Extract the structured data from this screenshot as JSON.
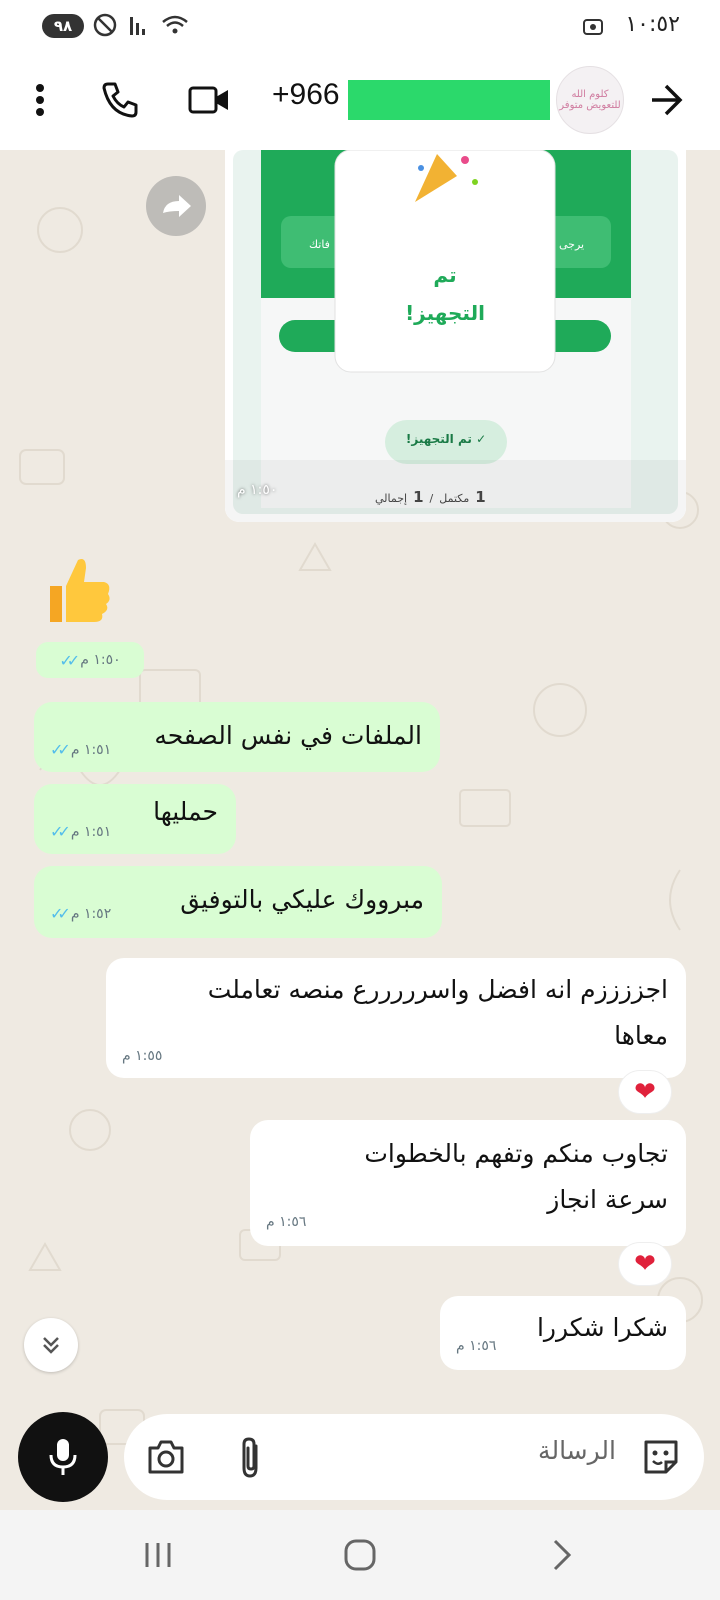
{
  "status_bar": {
    "battery": "٩٨",
    "time": "١٠:٥٢"
  },
  "header": {
    "contact_prefix": "+966",
    "avatar_text": "كلوم الله\nللتعويض متوفر"
  },
  "image_message": {
    "popup_title": "تم\nالتجهيز!",
    "badge": "✓ تم التجهيز!",
    "stat_complete_num": "1",
    "stat_complete_label": "مكتمل",
    "separator": "/",
    "stat_total_num": "1",
    "stat_total_label": "إجمالي",
    "banner_text_right": "يرجى",
    "banner_text_left": "فاتك",
    "time": "١:٥٠ م"
  },
  "messages": [
    {
      "id": "thumbs",
      "direction": "out",
      "emoji": "👍",
      "time": "١:٥٠ م",
      "read": true
    },
    {
      "id": "m1",
      "direction": "out",
      "text": "الملفات في نفس الصفحه",
      "time": "١:٥١ م",
      "read": true
    },
    {
      "id": "m2",
      "direction": "out",
      "text": "حمليها",
      "time": "١:٥١ م",
      "read": true
    },
    {
      "id": "m3",
      "direction": "out",
      "text": "مبرووك عليكي بالتوفيق",
      "time": "١:٥٢ م",
      "read": true
    },
    {
      "id": "m4",
      "direction": "in",
      "text_line1": "اجززززم انه افضل واسرررررع منصه تعاملت",
      "text_line2": "معاها",
      "time": "١:٥٥ م",
      "reaction": "❤"
    },
    {
      "id": "m5",
      "direction": "in",
      "text_line1": "تجاوب منكم وتفهم بالخطوات",
      "text_line2": "سرعة انجاز",
      "time": "١:٥٦ م",
      "reaction": "❤"
    },
    {
      "id": "m6",
      "direction": "in",
      "text": "شكرا شكررا",
      "time": "١:٥٦ م"
    }
  ],
  "input": {
    "placeholder": "الرسالة"
  },
  "colors": {
    "outgoing": "#d9fdd3",
    "incoming": "#ffffff",
    "accent_green": "#1faa59",
    "read_ticks": "#53bdeb"
  }
}
